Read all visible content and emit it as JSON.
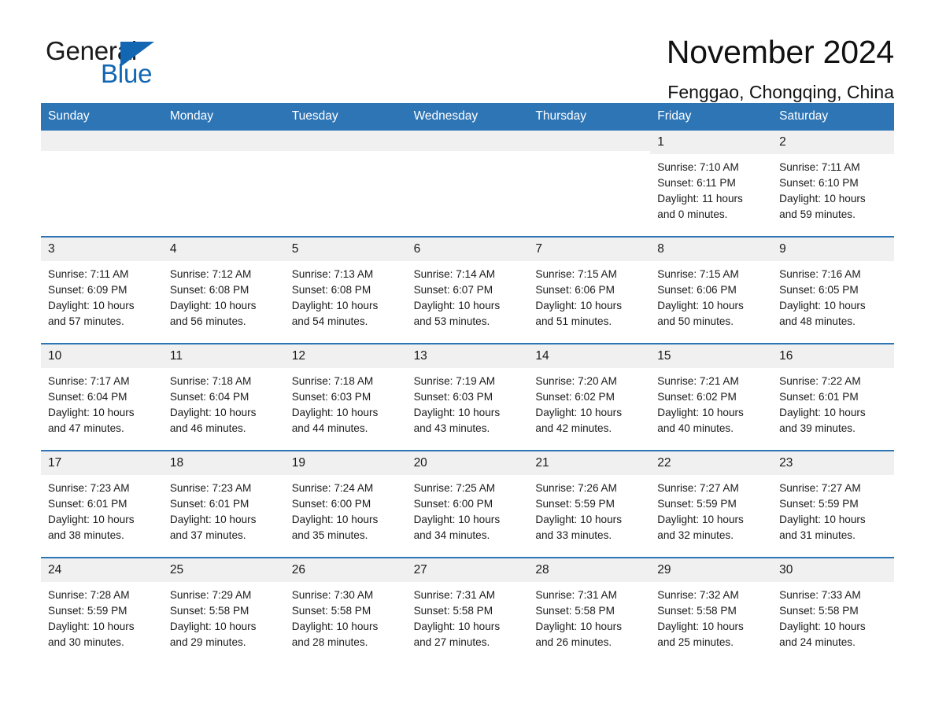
{
  "brand": {
    "name_part1": "General",
    "name_part2": "Blue",
    "logo_icon": "blue-triangle-icon"
  },
  "header": {
    "title": "November 2024",
    "location": "Fenggao, Chongqing, China"
  },
  "colors": {
    "header_blue": "#2e75b6",
    "brand_blue": "#1266b2",
    "daynum_band": "#f0f0f0",
    "text": "#1a1a1a"
  },
  "weekdays": [
    "Sunday",
    "Monday",
    "Tuesday",
    "Wednesday",
    "Thursday",
    "Friday",
    "Saturday"
  ],
  "weeks": [
    [
      {
        "day": "",
        "sunrise": "",
        "sunset": "",
        "daylight1": "",
        "daylight2": ""
      },
      {
        "day": "",
        "sunrise": "",
        "sunset": "",
        "daylight1": "",
        "daylight2": ""
      },
      {
        "day": "",
        "sunrise": "",
        "sunset": "",
        "daylight1": "",
        "daylight2": ""
      },
      {
        "day": "",
        "sunrise": "",
        "sunset": "",
        "daylight1": "",
        "daylight2": ""
      },
      {
        "day": "",
        "sunrise": "",
        "sunset": "",
        "daylight1": "",
        "daylight2": ""
      },
      {
        "day": "1",
        "sunrise": "Sunrise: 7:10 AM",
        "sunset": "Sunset: 6:11 PM",
        "daylight1": "Daylight: 11 hours",
        "daylight2": "and 0 minutes."
      },
      {
        "day": "2",
        "sunrise": "Sunrise: 7:11 AM",
        "sunset": "Sunset: 6:10 PM",
        "daylight1": "Daylight: 10 hours",
        "daylight2": "and 59 minutes."
      }
    ],
    [
      {
        "day": "3",
        "sunrise": "Sunrise: 7:11 AM",
        "sunset": "Sunset: 6:09 PM",
        "daylight1": "Daylight: 10 hours",
        "daylight2": "and 57 minutes."
      },
      {
        "day": "4",
        "sunrise": "Sunrise: 7:12 AM",
        "sunset": "Sunset: 6:08 PM",
        "daylight1": "Daylight: 10 hours",
        "daylight2": "and 56 minutes."
      },
      {
        "day": "5",
        "sunrise": "Sunrise: 7:13 AM",
        "sunset": "Sunset: 6:08 PM",
        "daylight1": "Daylight: 10 hours",
        "daylight2": "and 54 minutes."
      },
      {
        "day": "6",
        "sunrise": "Sunrise: 7:14 AM",
        "sunset": "Sunset: 6:07 PM",
        "daylight1": "Daylight: 10 hours",
        "daylight2": "and 53 minutes."
      },
      {
        "day": "7",
        "sunrise": "Sunrise: 7:15 AM",
        "sunset": "Sunset: 6:06 PM",
        "daylight1": "Daylight: 10 hours",
        "daylight2": "and 51 minutes."
      },
      {
        "day": "8",
        "sunrise": "Sunrise: 7:15 AM",
        "sunset": "Sunset: 6:06 PM",
        "daylight1": "Daylight: 10 hours",
        "daylight2": "and 50 minutes."
      },
      {
        "day": "9",
        "sunrise": "Sunrise: 7:16 AM",
        "sunset": "Sunset: 6:05 PM",
        "daylight1": "Daylight: 10 hours",
        "daylight2": "and 48 minutes."
      }
    ],
    [
      {
        "day": "10",
        "sunrise": "Sunrise: 7:17 AM",
        "sunset": "Sunset: 6:04 PM",
        "daylight1": "Daylight: 10 hours",
        "daylight2": "and 47 minutes."
      },
      {
        "day": "11",
        "sunrise": "Sunrise: 7:18 AM",
        "sunset": "Sunset: 6:04 PM",
        "daylight1": "Daylight: 10 hours",
        "daylight2": "and 46 minutes."
      },
      {
        "day": "12",
        "sunrise": "Sunrise: 7:18 AM",
        "sunset": "Sunset: 6:03 PM",
        "daylight1": "Daylight: 10 hours",
        "daylight2": "and 44 minutes."
      },
      {
        "day": "13",
        "sunrise": "Sunrise: 7:19 AM",
        "sunset": "Sunset: 6:03 PM",
        "daylight1": "Daylight: 10 hours",
        "daylight2": "and 43 minutes."
      },
      {
        "day": "14",
        "sunrise": "Sunrise: 7:20 AM",
        "sunset": "Sunset: 6:02 PM",
        "daylight1": "Daylight: 10 hours",
        "daylight2": "and 42 minutes."
      },
      {
        "day": "15",
        "sunrise": "Sunrise: 7:21 AM",
        "sunset": "Sunset: 6:02 PM",
        "daylight1": "Daylight: 10 hours",
        "daylight2": "and 40 minutes."
      },
      {
        "day": "16",
        "sunrise": "Sunrise: 7:22 AM",
        "sunset": "Sunset: 6:01 PM",
        "daylight1": "Daylight: 10 hours",
        "daylight2": "and 39 minutes."
      }
    ],
    [
      {
        "day": "17",
        "sunrise": "Sunrise: 7:23 AM",
        "sunset": "Sunset: 6:01 PM",
        "daylight1": "Daylight: 10 hours",
        "daylight2": "and 38 minutes."
      },
      {
        "day": "18",
        "sunrise": "Sunrise: 7:23 AM",
        "sunset": "Sunset: 6:01 PM",
        "daylight1": "Daylight: 10 hours",
        "daylight2": "and 37 minutes."
      },
      {
        "day": "19",
        "sunrise": "Sunrise: 7:24 AM",
        "sunset": "Sunset: 6:00 PM",
        "daylight1": "Daylight: 10 hours",
        "daylight2": "and 35 minutes."
      },
      {
        "day": "20",
        "sunrise": "Sunrise: 7:25 AM",
        "sunset": "Sunset: 6:00 PM",
        "daylight1": "Daylight: 10 hours",
        "daylight2": "and 34 minutes."
      },
      {
        "day": "21",
        "sunrise": "Sunrise: 7:26 AM",
        "sunset": "Sunset: 5:59 PM",
        "daylight1": "Daylight: 10 hours",
        "daylight2": "and 33 minutes."
      },
      {
        "day": "22",
        "sunrise": "Sunrise: 7:27 AM",
        "sunset": "Sunset: 5:59 PM",
        "daylight1": "Daylight: 10 hours",
        "daylight2": "and 32 minutes."
      },
      {
        "day": "23",
        "sunrise": "Sunrise: 7:27 AM",
        "sunset": "Sunset: 5:59 PM",
        "daylight1": "Daylight: 10 hours",
        "daylight2": "and 31 minutes."
      }
    ],
    [
      {
        "day": "24",
        "sunrise": "Sunrise: 7:28 AM",
        "sunset": "Sunset: 5:59 PM",
        "daylight1": "Daylight: 10 hours",
        "daylight2": "and 30 minutes."
      },
      {
        "day": "25",
        "sunrise": "Sunrise: 7:29 AM",
        "sunset": "Sunset: 5:58 PM",
        "daylight1": "Daylight: 10 hours",
        "daylight2": "and 29 minutes."
      },
      {
        "day": "26",
        "sunrise": "Sunrise: 7:30 AM",
        "sunset": "Sunset: 5:58 PM",
        "daylight1": "Daylight: 10 hours",
        "daylight2": "and 28 minutes."
      },
      {
        "day": "27",
        "sunrise": "Sunrise: 7:31 AM",
        "sunset": "Sunset: 5:58 PM",
        "daylight1": "Daylight: 10 hours",
        "daylight2": "and 27 minutes."
      },
      {
        "day": "28",
        "sunrise": "Sunrise: 7:31 AM",
        "sunset": "Sunset: 5:58 PM",
        "daylight1": "Daylight: 10 hours",
        "daylight2": "and 26 minutes."
      },
      {
        "day": "29",
        "sunrise": "Sunrise: 7:32 AM",
        "sunset": "Sunset: 5:58 PM",
        "daylight1": "Daylight: 10 hours",
        "daylight2": "and 25 minutes."
      },
      {
        "day": "30",
        "sunrise": "Sunrise: 7:33 AM",
        "sunset": "Sunset: 5:58 PM",
        "daylight1": "Daylight: 10 hours",
        "daylight2": "and 24 minutes."
      }
    ]
  ]
}
